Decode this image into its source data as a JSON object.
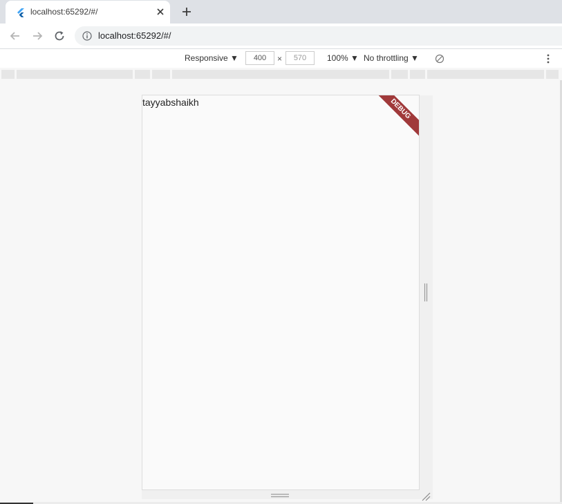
{
  "browser": {
    "tab": {
      "title": "localhost:65292/#/",
      "favicon": "flutter-icon"
    },
    "url": "localhost:65292/#/"
  },
  "devtools": {
    "device_mode": "Responsive",
    "width": "400",
    "height": "570",
    "dim_separator": "×",
    "zoom": "100%",
    "throttling": "No throttling",
    "dropdown_arrow": "▼"
  },
  "app": {
    "text": "tayyabshaikh",
    "debug_banner": "DEBUG"
  },
  "colors": {
    "debug_ribbon": "#a0393a",
    "tab_strip": "#dee1e6",
    "flutter_blue": "#42a5f5"
  }
}
